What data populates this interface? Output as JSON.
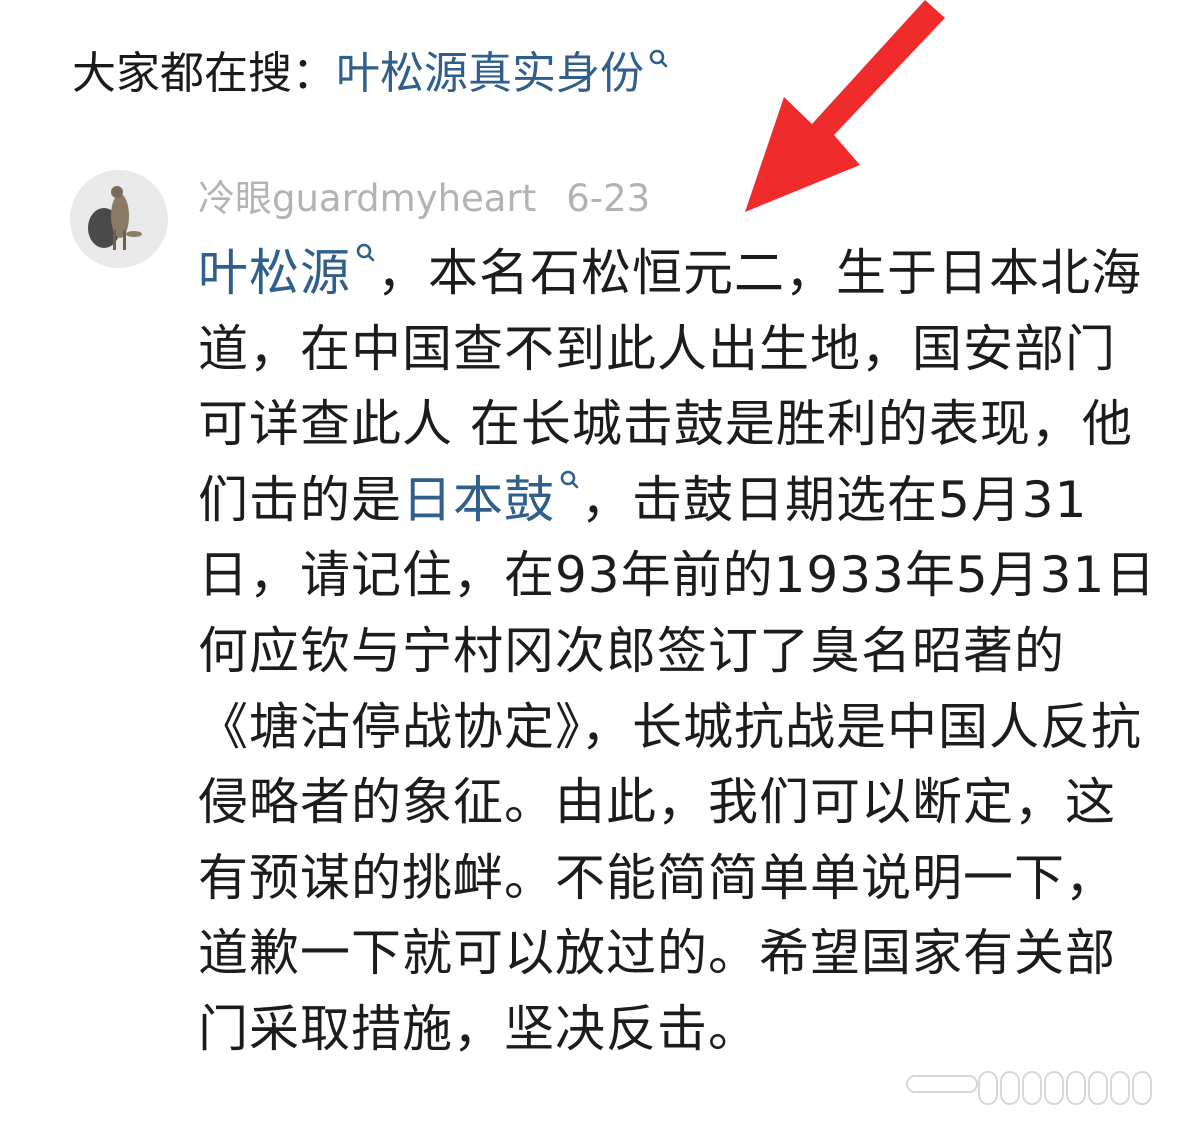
{
  "search_bar": {
    "prefix": "大家都在搜：",
    "query_link": "叶松源真实身份",
    "icon": "search-icon",
    "link_color": "#2f5f8a"
  },
  "comment": {
    "avatar_icon": "meerkat-avatar",
    "username": "冷眼guardmyheart",
    "date": "6-23",
    "segments": [
      {
        "text": "叶松源",
        "link": true
      },
      {
        "text": "，本名石松恒元二，生于日本北海道，在中国查不到此人出生地，国安部门可详查此人 在长城击鼓是胜利的表现，他们击的是",
        "link": false
      },
      {
        "text": "日本鼓",
        "link": true
      },
      {
        "text": "，击鼓日期选在5月31日，请记住，在93年前的1933年5月31日何应钦与宁村冈次郎签订了臭名昭著的《塘沽停战协定》，长城抗战是中国人反抗侵略者的象征。由此，我们可以断定，这有预谋的挑衅。不能简简单单说明一下，道歉一下就可以放过的。希望国家有关部门采取措施，坚决反击。",
        "link": false
      }
    ],
    "text_color": "#1c1c1c"
  },
  "annotation": {
    "icon": "red-arrow-icon",
    "color": "#f02b2b"
  },
  "overlay": {
    "icon": "watermark-bars-icon"
  }
}
